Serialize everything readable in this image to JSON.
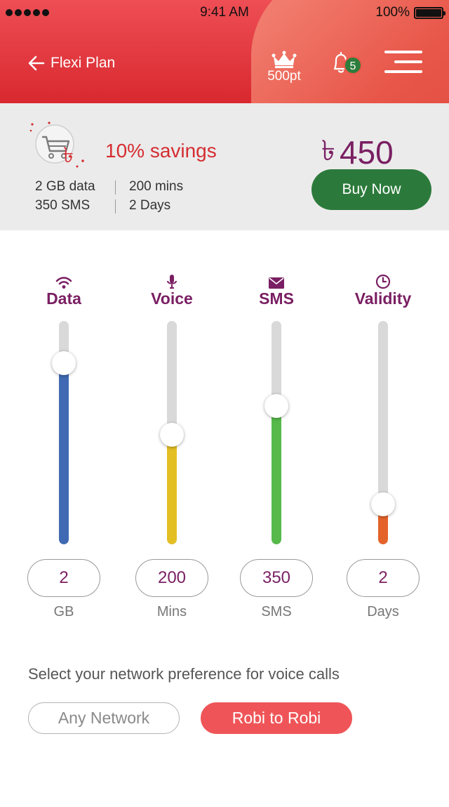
{
  "status_bar": {
    "time": "9:41 AM",
    "battery": "100%"
  },
  "header": {
    "title": "Flexi Plan",
    "points_label": "500pt",
    "notification_count": "5",
    "icons": [
      "back-arrow-icon",
      "crown-icon",
      "bell-icon",
      "menu-icon"
    ]
  },
  "summary": {
    "savings_text": "10% savings",
    "specs": [
      "2 GB data",
      "200 mins",
      "350 SMS",
      "2 Days"
    ],
    "currency": "৳",
    "price": "450",
    "buy_label": "Buy Now"
  },
  "sliders": [
    {
      "label": "Data",
      "value": "2",
      "unit": "GB",
      "level": 0.81,
      "icon": "wifi-icon",
      "color": "#3f6ab3"
    },
    {
      "label": "Voice",
      "value": "200",
      "unit": "Mins",
      "level": 0.49,
      "icon": "microphone-icon",
      "color": "#e4bf24"
    },
    {
      "label": "SMS",
      "value": "350",
      "unit": "SMS",
      "level": 0.62,
      "icon": "envelope-icon",
      "color": "#56b94a"
    },
    {
      "label": "Validity",
      "value": "2",
      "unit": "Days",
      "level": 0.18,
      "icon": "clock-icon",
      "color": "#e4632a"
    }
  ],
  "network": {
    "prompt": "Select your network preference for voice calls",
    "options": [
      "Any Network",
      "Robi to Robi"
    ],
    "selected": "Robi to Robi"
  },
  "colors": {
    "accent": "#d52d31",
    "brand_purple": "#7a1f63",
    "buy_green": "#2c7a3b"
  }
}
